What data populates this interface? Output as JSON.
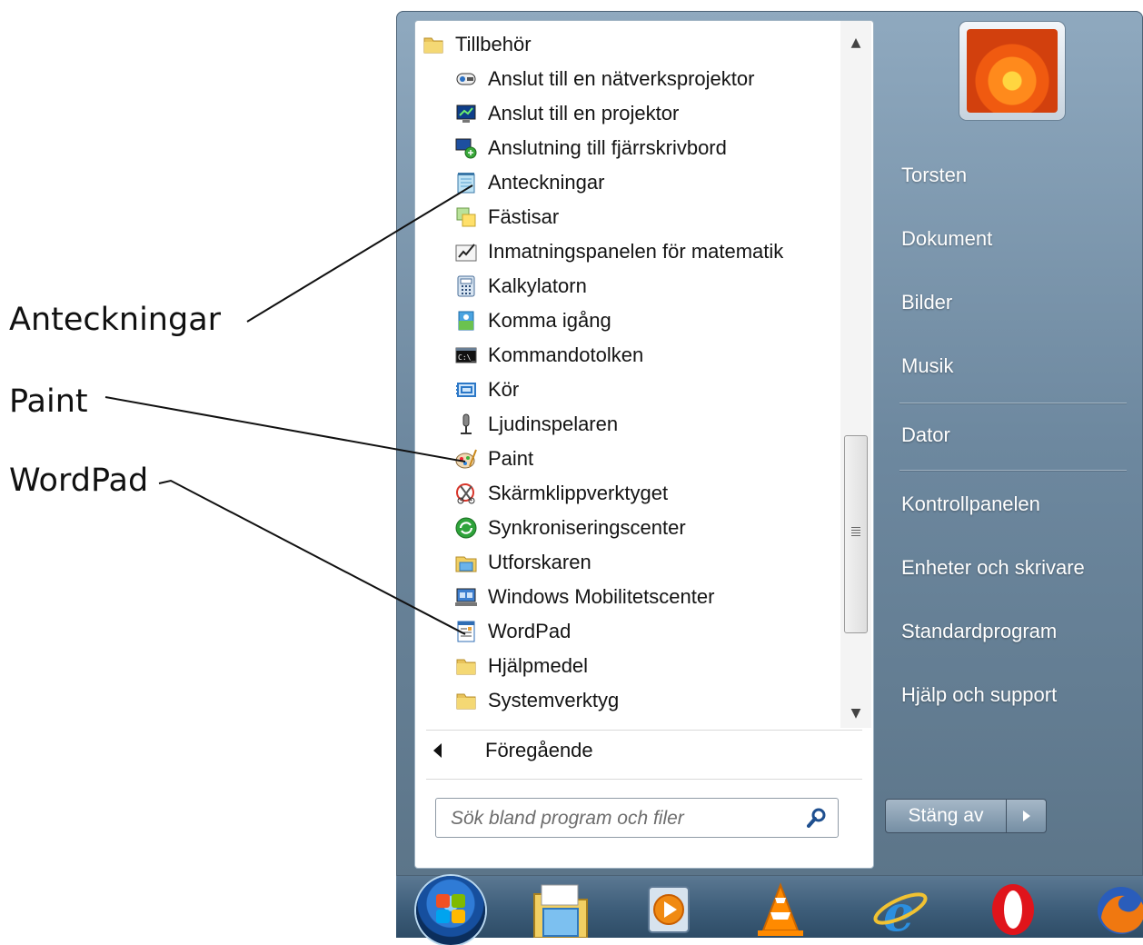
{
  "callouts": [
    {
      "name": "callout-anteckningar",
      "label": "Anteckningar"
    },
    {
      "name": "callout-paint",
      "label": "Paint"
    },
    {
      "name": "callout-wordpad",
      "label": "WordPad"
    }
  ],
  "programs": {
    "folder": {
      "label": "Tillbehör",
      "icon": "folder-icon"
    },
    "items": [
      {
        "label": "Anslut till en nätverksprojektor",
        "icon": "network-projector-icon"
      },
      {
        "label": "Anslut till en projektor",
        "icon": "projector-icon"
      },
      {
        "label": "Anslutning till fjärrskrivbord",
        "icon": "remote-desktop-icon"
      },
      {
        "label": "Anteckningar",
        "icon": "notepad-icon"
      },
      {
        "label": "Fästisar",
        "icon": "sticky-notes-icon"
      },
      {
        "label": "Inmatningspanelen för matematik",
        "icon": "math-input-icon"
      },
      {
        "label": "Kalkylatorn",
        "icon": "calculator-icon"
      },
      {
        "label": "Komma igång",
        "icon": "getting-started-icon"
      },
      {
        "label": "Kommandotolken",
        "icon": "command-prompt-icon"
      },
      {
        "label": "Kör",
        "icon": "run-icon"
      },
      {
        "label": "Ljudinspelaren",
        "icon": "sound-recorder-icon"
      },
      {
        "label": "Paint",
        "icon": "paint-icon"
      },
      {
        "label": "Skärmklippverktyget",
        "icon": "snipping-tool-icon"
      },
      {
        "label": "Synkroniseringscenter",
        "icon": "sync-center-icon"
      },
      {
        "label": "Utforskaren",
        "icon": "explorer-icon"
      },
      {
        "label": "Windows Mobilitetscenter",
        "icon": "mobility-center-icon"
      },
      {
        "label": "WordPad",
        "icon": "wordpad-icon"
      },
      {
        "label": "Hjälpmedel",
        "icon": "folder-icon"
      },
      {
        "label": "Systemverktyg",
        "icon": "folder-icon"
      }
    ],
    "back_label": "Föregående"
  },
  "search": {
    "placeholder": "Sök bland program och filer"
  },
  "right_pane": {
    "items": [
      "Torsten",
      "Dokument",
      "Bilder",
      "Musik",
      "Dator",
      "Kontrollpanelen",
      "Enheter och skrivare",
      "Standardprogram",
      "Hjälp och support"
    ]
  },
  "shutdown": {
    "label": "Stäng av"
  },
  "taskbar": {
    "icons": [
      "start-orb-icon",
      "file-explorer-icon",
      "media-player-icon",
      "vlc-icon",
      "internet-explorer-icon",
      "opera-icon",
      "firefox-icon"
    ]
  },
  "colors": {
    "menu_blue": "#6d889f",
    "taskbar": "#3d5d79"
  }
}
